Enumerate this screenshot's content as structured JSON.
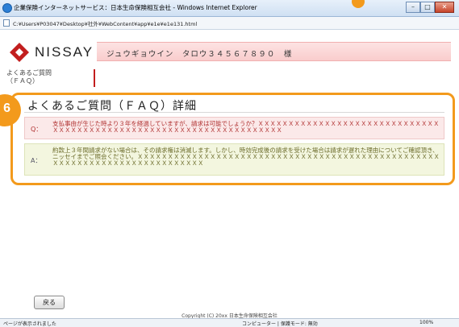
{
  "window": {
    "title": "企業保険インターネットサービス：日本生命保険相互会社 - Windows Internet Explorer",
    "minimize": "–",
    "maximize": "□",
    "close": "✕"
  },
  "address": {
    "url": "C:¥Users¥P03047¥Desktop¥社外¥WebContent¥app¥e1e¥e1e131.html"
  },
  "header": {
    "logo_text": "NISSAY",
    "user_name": "ジュウギョウイン　タロウ３４５６７８９０　様"
  },
  "breadcrumb": {
    "line1": "よくあるご質問",
    "line2": "（ＦＡＱ）"
  },
  "callout": {
    "badge": "6"
  },
  "faq": {
    "title": "よくあるご質問（ＦＡＱ）詳細",
    "q_mark": "Q：",
    "question": "支払事由が生じた時より３年を経過していますが、請求は可能でしょうか？ＸＸＸＸＸＸＸＸＸＸＸＸＸＸＸＸＸＸＸＸＸＸＸＸＸＸＸＸＸＸＸＸＸＸＸＸＸＸＸＸＸＸＸＸＸＸＸＸＸＸＸＸＸＸＸＸＸＸＸＸＸＸＸＸＸＸＸＸ",
    "a_mark": "A：",
    "answer": "約款上３年間請求がない場合は、その請求権は消滅します。しかし、時効完成後の請求を受けた場合は請求が遅れた理由についてご確認頂き、ニッセイまでご照会ください。ＸＸＸＸＸＸＸＸＸＸＸＸＸＸＸＸＸＸＸＸＸＸＸＸＸＸＸＸＸＸＸＸＸＸＸＸＸＸＸＸＸＸＸＸＸＸＸＸＸＸＸＸＸＸＸＸＸＸＸＸＸＸＸＸＸＸＸＸＸＸＸＸＸＸＸ"
  },
  "footer": {
    "back_label": "戻る",
    "copyright": "Copyright (C) 20xx 日本生命保険相互会社"
  },
  "status": {
    "left": "ページが表示されました",
    "zone": "コンピューター | 保護モード: 無効",
    "zoom": "100%"
  },
  "colors": {
    "accent": "#f39a1c",
    "brand_red": "#c21e1e",
    "question_bg": "#fbe9e9",
    "answer_bg": "#f3f6df"
  }
}
